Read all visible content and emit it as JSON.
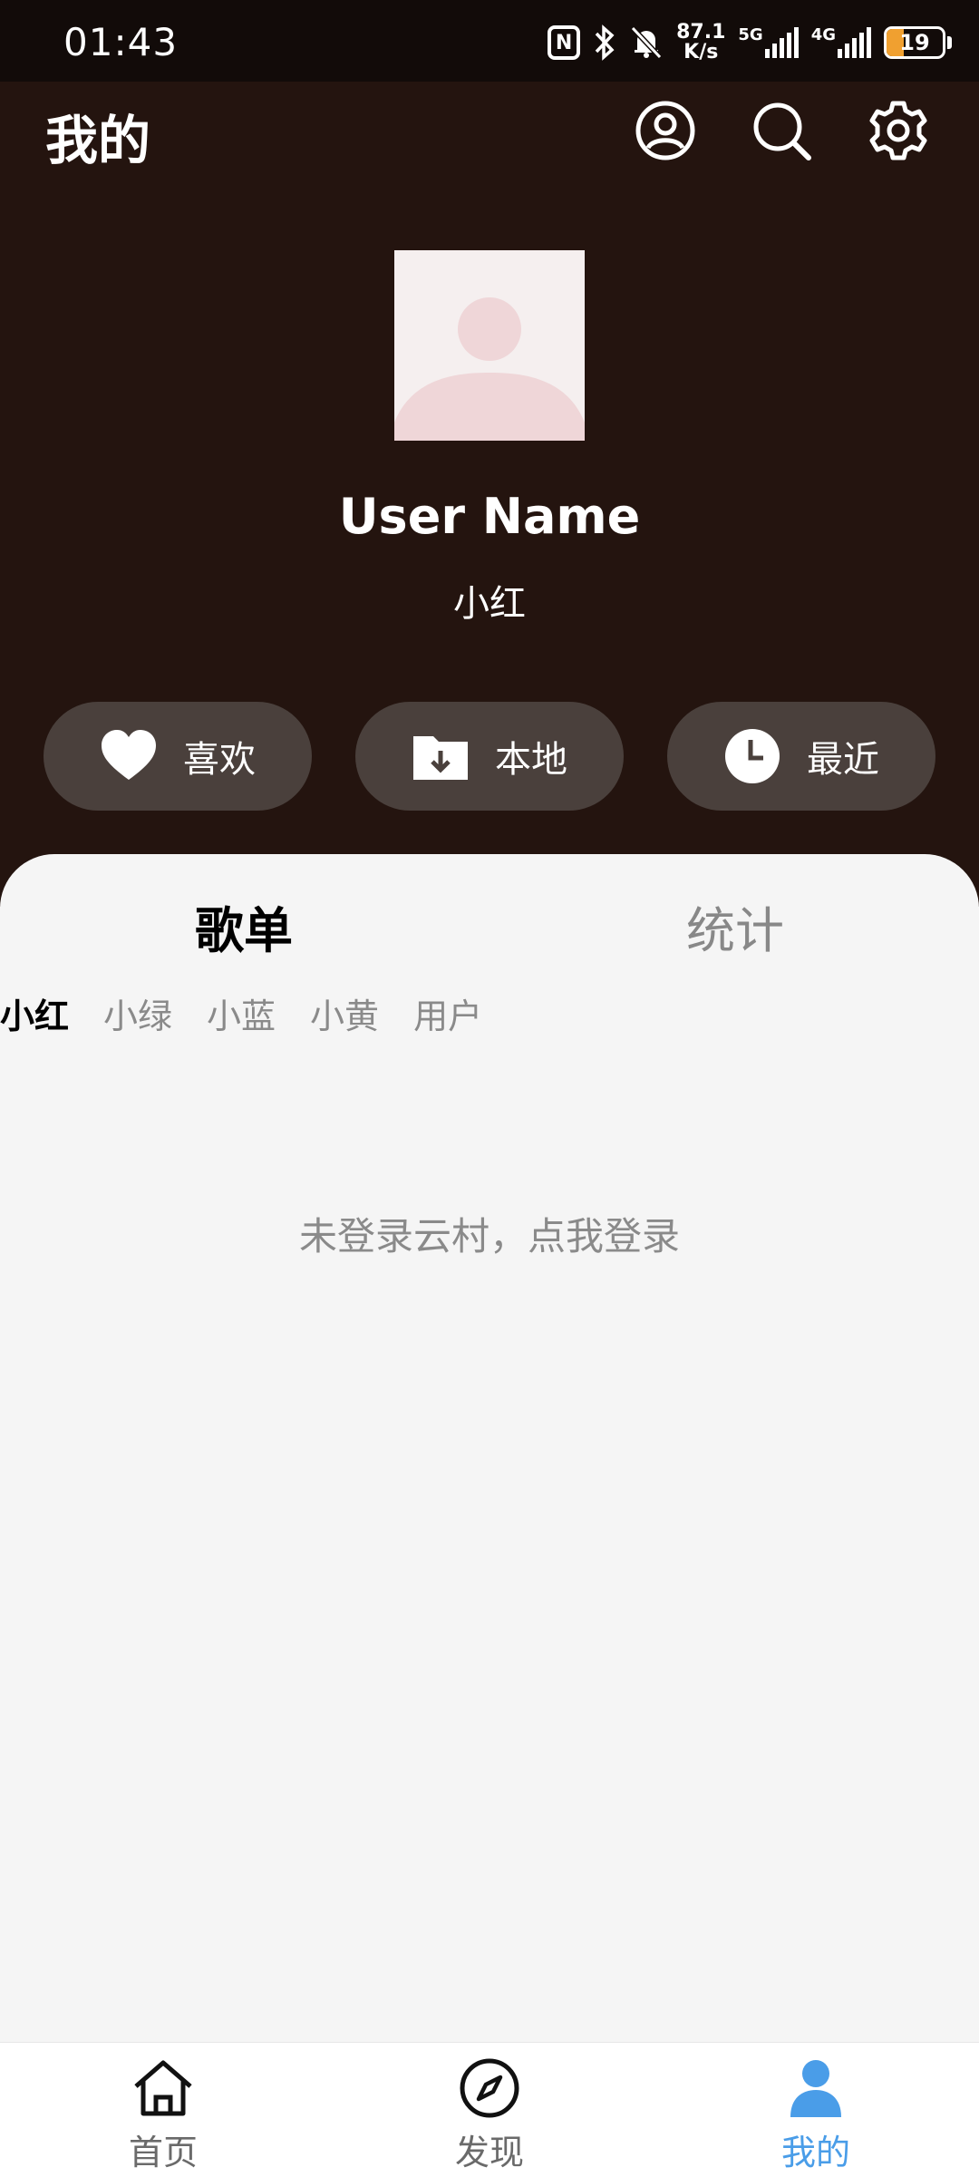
{
  "status_bar": {
    "time": "01:43",
    "net_speed_value": "87.1",
    "net_speed_unit": "K/s",
    "net_5g": "5G",
    "net_4g": "4G",
    "battery_level": "19"
  },
  "header": {
    "title": "我的",
    "icons": [
      "account-circle-icon",
      "search-icon",
      "settings-icon"
    ]
  },
  "profile": {
    "user_name": "User Name",
    "subtitle": "小红"
  },
  "quick_actions": [
    {
      "label": "喜欢",
      "icon": "heart-icon"
    },
    {
      "label": "本地",
      "icon": "folder-download-icon"
    },
    {
      "label": "最近",
      "icon": "clock-icon"
    }
  ],
  "tabs": [
    {
      "label": "歌单",
      "active": true
    },
    {
      "label": "统计",
      "active": false
    }
  ],
  "chips": [
    {
      "label": "小红",
      "active": true
    },
    {
      "label": "小绿",
      "active": false
    },
    {
      "label": "小蓝",
      "active": false
    },
    {
      "label": "小黄",
      "active": false
    },
    {
      "label": "用户",
      "active": false
    }
  ],
  "login_prompt": "未登录云村，点我登录",
  "bottom_nav": [
    {
      "label": "首页",
      "icon": "home-icon",
      "active": false
    },
    {
      "label": "发现",
      "icon": "compass-icon",
      "active": false
    },
    {
      "label": "我的",
      "icon": "person-icon",
      "active": true
    }
  ],
  "colors": {
    "header_bg": "#24140f",
    "pill_bg": "#4a403c",
    "active_nav": "#4a9de8",
    "battery_fill": "#f0a030"
  }
}
